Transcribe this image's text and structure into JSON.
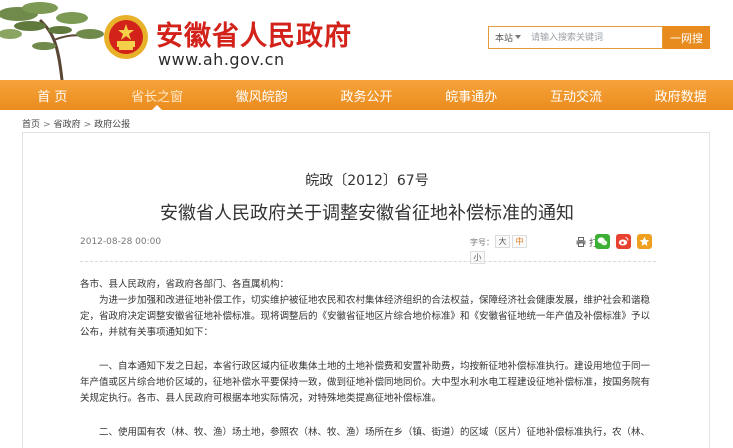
{
  "site": {
    "title": "安徽省人民政府",
    "url": "www.ah.gov.cn"
  },
  "search": {
    "scope": "本站",
    "placeholder": "请输入搜索关键词",
    "button_label": "一网搜"
  },
  "nav": {
    "items": [
      {
        "label": "首 页"
      },
      {
        "label": "省长之窗"
      },
      {
        "label": "徽风皖韵"
      },
      {
        "label": "政务公开"
      },
      {
        "label": "皖事通办"
      },
      {
        "label": "互动交流"
      },
      {
        "label": "政府数据"
      }
    ],
    "active_index": 1
  },
  "breadcrumb": {
    "items": [
      "首页",
      "省政府",
      "政府公报"
    ],
    "separator": ">"
  },
  "article": {
    "doc_number": "皖政〔2012〕67号",
    "title": "安徽省人民政府关于调整安徽省征地补偿标准的通知",
    "date": "2012-08-28 00:00",
    "font_size_label": "字号：",
    "font_sizes": [
      "大",
      "中",
      "小"
    ],
    "print_label": "打印",
    "share_icons": [
      "wechat-icon",
      "weibo-icon",
      "qzone-icon"
    ],
    "paragraphs": [
      "各市、县人民政府，省政府各部门、各直属机构：",
      "为进一步加强和改进征地补偿工作，切实维护被征地农民和农村集体经济组织的合法权益，保障经济社会健康发展，维护社会和谐稳定，省政府决定调整安徽省征地补偿标准。现将调整后的《安徽省征地区片综合地价标准》和《安徽省征地统一年产值及补偿标准》予以公布，并就有关事项通知如下：",
      "一、自本通知下发之日起，本省行政区域内征收集体土地的土地补偿费和安置补助费，均按新征地补偿标准执行。建设用地位于同一年产值或区片综合地价区域的，征地补偿水平要保持一致，做到征地补偿同地同价。大中型水利水电工程建设征地补偿标准，按国务院有关规定执行。各市、县人民政府可根据本地实际情况，对特殊地类提高征地补偿标准。",
      "二、使用国有农（林、牧、渔）场土地，参照农（林、牧、渔）场所在乡（镇、街道）的区域（区片）征地补偿标准执行，农（林、"
    ]
  },
  "colors": {
    "brand_red": "#d2221a",
    "nav_orange": "#ec8c1e",
    "search_button": "#e88b1f",
    "font_size_active": "#e07a1a",
    "wechat_green": "#3cb034",
    "weibo_red": "#e8412f",
    "qzone_yellow": "#f0a020"
  }
}
